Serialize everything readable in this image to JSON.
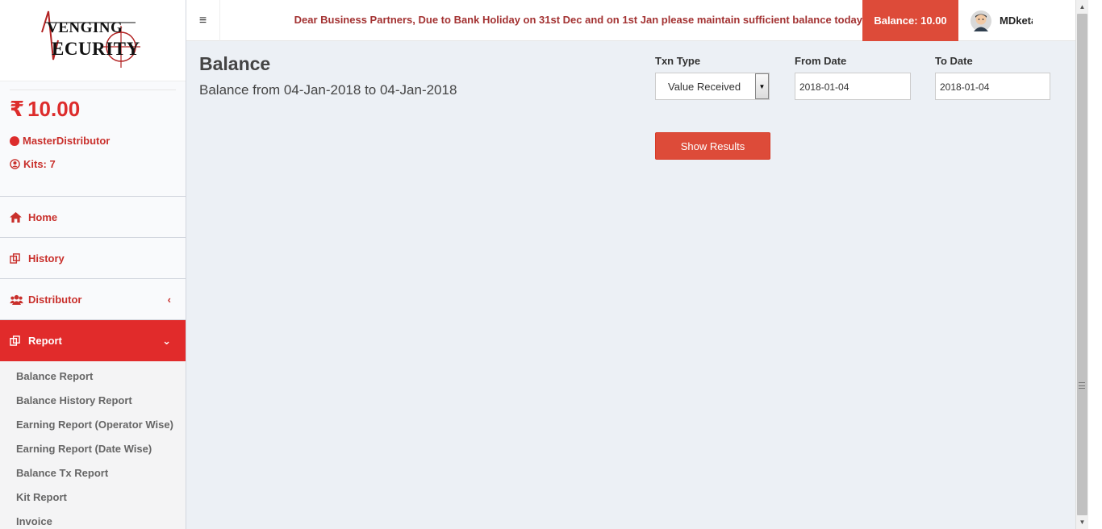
{
  "brand": {
    "logo_line1": "VENGING",
    "logo_line2": "ECURITY",
    "logo_initials": "AS"
  },
  "sidebar": {
    "wallet": {
      "currency": "₹",
      "amount": "10.00"
    },
    "role": "MasterDistributor",
    "kits": "Kits: 7",
    "items": [
      {
        "label": "Home",
        "icon": "home-icon"
      },
      {
        "label": "History",
        "icon": "copy-icon"
      },
      {
        "label": "Distributor",
        "icon": "users-icon",
        "chevron": "‹"
      },
      {
        "label": "Report",
        "icon": "copy-icon",
        "chevron": "⌄",
        "active": true
      }
    ],
    "report_subitems": [
      "Balance Report",
      "Balance History Report",
      "Earning Report (Operator Wise)",
      "Earning Report (Date Wise)",
      "Balance Tx Report",
      "Kit Report",
      "Invoice"
    ]
  },
  "header": {
    "toggle": "≡",
    "notice": "Dear Business Partners, Due to Bank Holiday on 31st Dec and on 1st Jan please maintain sufficient balance today",
    "balance_label": "Balance: 10.00",
    "user_name": "MDketan"
  },
  "main": {
    "title": "Balance",
    "subtitle": "Balance from 04-Jan-2018 to 04-Jan-2018",
    "txn_type_label": "Txn Type",
    "txn_type_value": "Value Received",
    "from_date_label": "From Date",
    "from_date_value": "2018-01-04",
    "to_date_label": "To Date",
    "to_date_value": "2018-01-04",
    "show_results": "Show Results"
  },
  "colors": {
    "accent": "#dd4b39",
    "sidebar_active": "#e12b2b",
    "sidebar_text": "#c9302c",
    "content_bg": "#ecf0f5"
  }
}
